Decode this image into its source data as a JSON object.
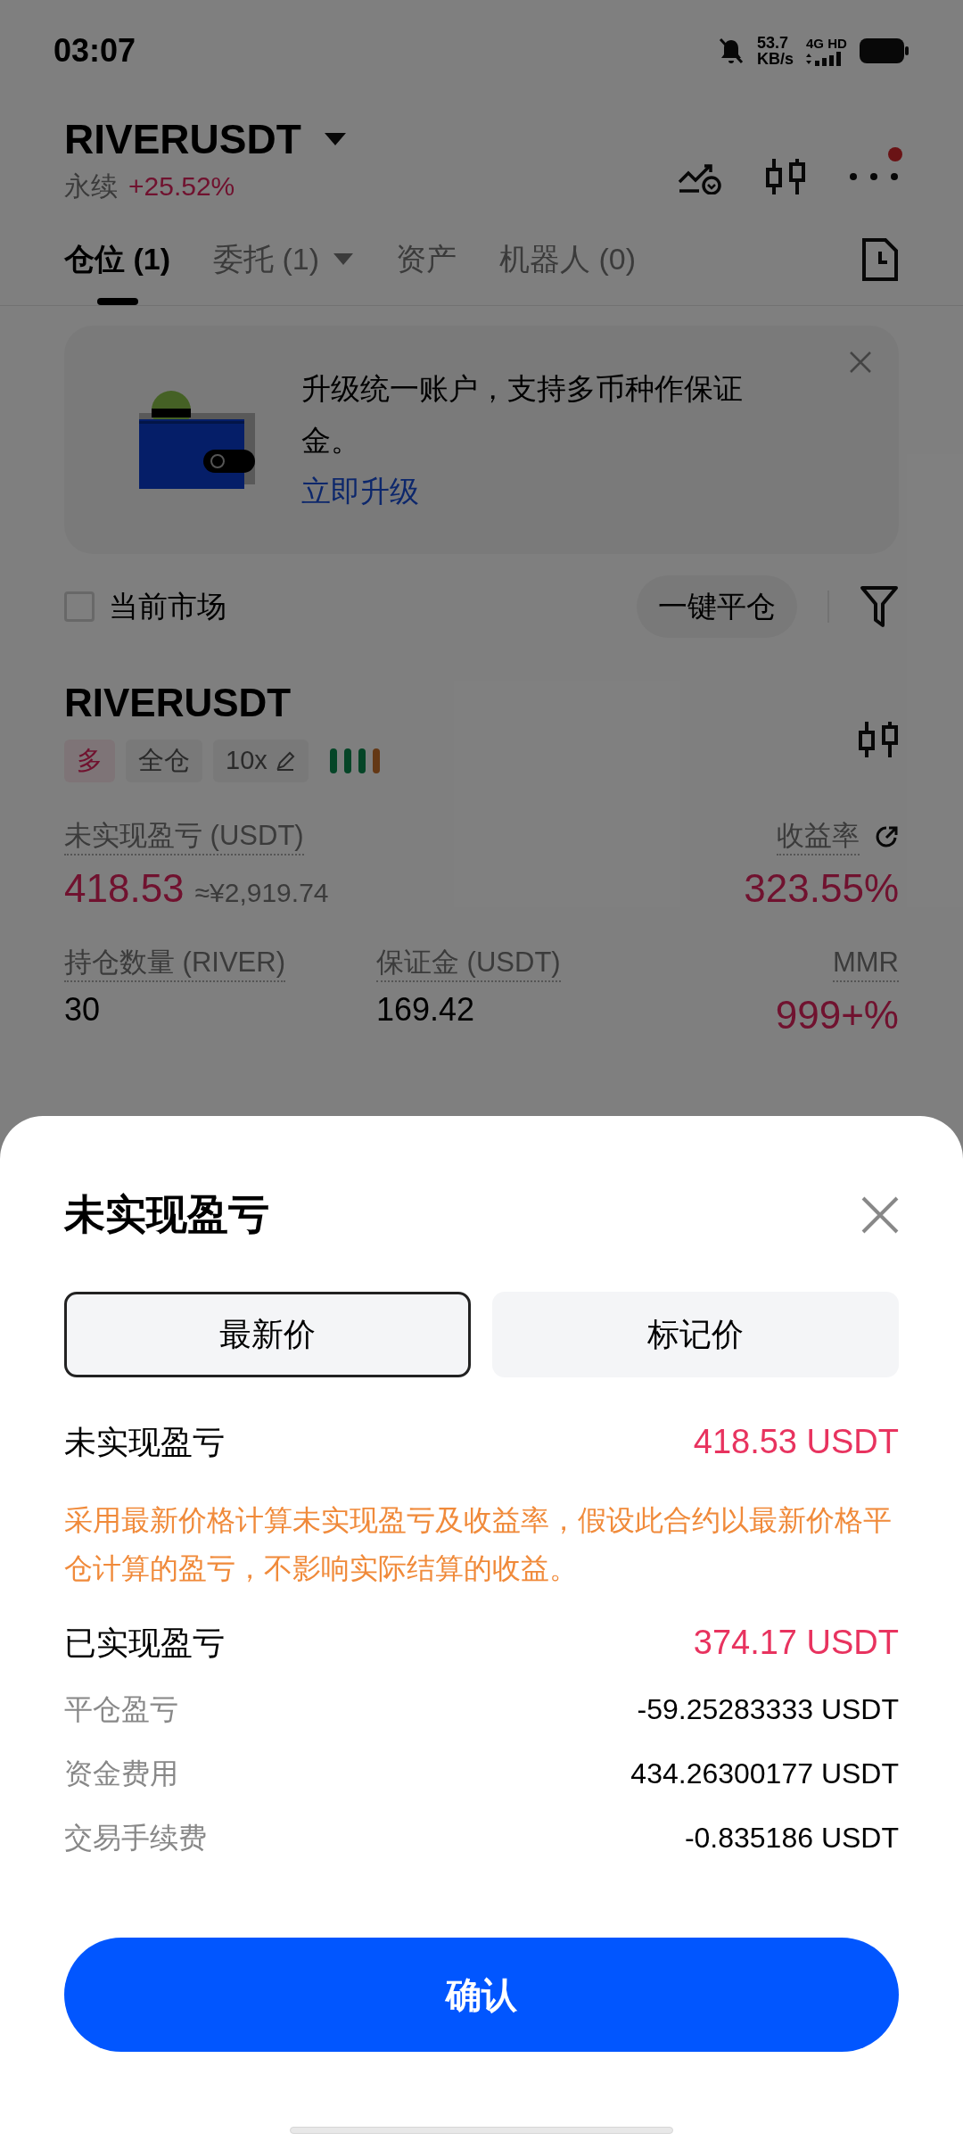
{
  "status_bar": {
    "time": "03:07",
    "speed_value": "53.7",
    "speed_unit": "KB/s",
    "network": "4G HD"
  },
  "header": {
    "symbol": "RIVERUSDT",
    "contract_type": "永续",
    "change": "+25.52%",
    "notification_dot": true
  },
  "tabs": [
    {
      "label": "仓位 (1)",
      "selected": true,
      "dropdown": false
    },
    {
      "label": "委托 (1)",
      "selected": false,
      "dropdown": true
    },
    {
      "label": "资产",
      "selected": false,
      "dropdown": false
    },
    {
      "label": "机器人 (0)",
      "selected": false,
      "dropdown": false
    }
  ],
  "banner": {
    "text": "升级统一账户，支持多币种作保证金。",
    "link": "立即升级"
  },
  "filter": {
    "label": "当前市场",
    "checked": false,
    "close_all": "一键平仓"
  },
  "position": {
    "symbol": "RIVERUSDT",
    "tags": [
      {
        "label": "多",
        "kind": "side"
      },
      {
        "label": "全仓",
        "kind": "plain"
      },
      {
        "label": "10x",
        "kind": "leverage"
      }
    ],
    "metrics": [
      {
        "label": "未实现盈亏 (USDT)",
        "value": "418.53",
        "note": "≈¥2,919.74",
        "kind": "pnl"
      },
      {
        "label": "收益率",
        "value": "323.55%",
        "kind": "pnl"
      },
      {
        "label": "持仓数量 (RIVER)",
        "value": "30",
        "kind": "plain"
      },
      {
        "label": "保证金 (USDT)",
        "value": "169.42",
        "kind": "plain"
      },
      {
        "label": "MMR",
        "value": "999+%",
        "kind": "pnl"
      }
    ]
  },
  "sheet": {
    "title": "未实现盈亏",
    "price_tabs": [
      {
        "label": "最新价",
        "selected": true
      },
      {
        "label": "标记价",
        "selected": false
      }
    ],
    "unrealized": {
      "label": "未实现盈亏",
      "value": "418.53 USDT"
    },
    "note": "采用最新价格计算未实现盈亏及收益率，假设此合约以最新价格平仓计算的盈亏，不影响实际结算的收益。",
    "realized": {
      "label": "已实现盈亏",
      "value": "374.17 USDT"
    },
    "details": [
      {
        "label": "平仓盈亏",
        "value": "-59.25283333 USDT"
      },
      {
        "label": "资金费用",
        "value": "434.26300177 USDT"
      },
      {
        "label": "交易手续费",
        "value": "-0.835186 USDT"
      }
    ],
    "confirm": "确认"
  }
}
